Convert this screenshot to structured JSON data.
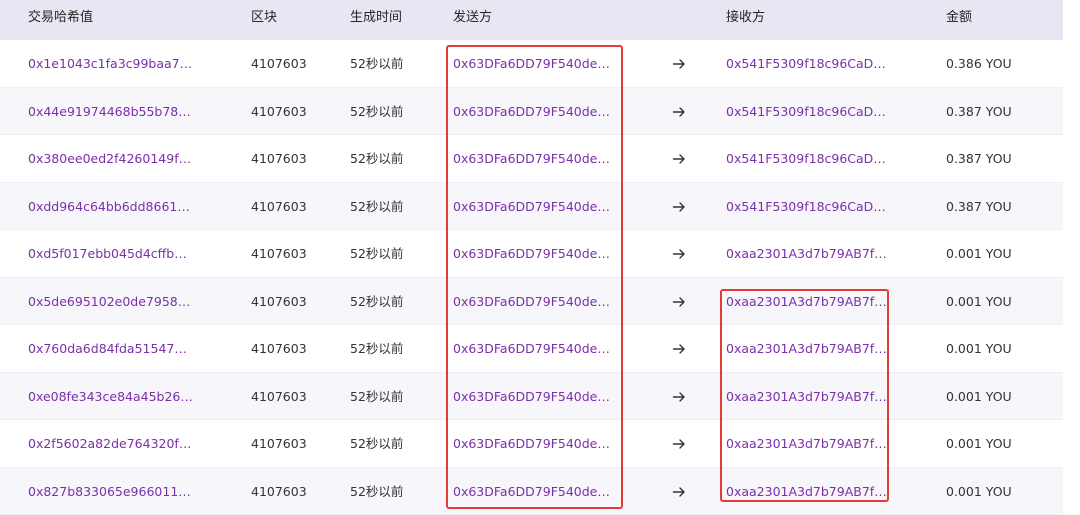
{
  "columns": {
    "hash": "交易哈希值",
    "block": "区块",
    "time": "生成时间",
    "from": "发送方",
    "to": "接收方",
    "amount": "金额"
  },
  "accent_link_color": "#7b2fa8",
  "highlight_color": "#e53a35",
  "rows": [
    {
      "hash": "0x1e1043c1fa3c99baa7…",
      "block": "4107603",
      "time": "52秒以前",
      "from": "0x63DFa6DD79F540de…",
      "to": "0x541F5309f18c96CaD…",
      "amount": "0.386 YOU"
    },
    {
      "hash": "0x44e91974468b55b78…",
      "block": "4107603",
      "time": "52秒以前",
      "from": "0x63DFa6DD79F540de…",
      "to": "0x541F5309f18c96CaD…",
      "amount": "0.387 YOU"
    },
    {
      "hash": "0x380ee0ed2f4260149f…",
      "block": "4107603",
      "time": "52秒以前",
      "from": "0x63DFa6DD79F540de…",
      "to": "0x541F5309f18c96CaD…",
      "amount": "0.387 YOU"
    },
    {
      "hash": "0xdd964c64bb6dd8661…",
      "block": "4107603",
      "time": "52秒以前",
      "from": "0x63DFa6DD79F540de…",
      "to": "0x541F5309f18c96CaD…",
      "amount": "0.387 YOU"
    },
    {
      "hash": "0xd5f017ebb045d4cffb…",
      "block": "4107603",
      "time": "52秒以前",
      "from": "0x63DFa6DD79F540de…",
      "to": "0xaa2301A3d7b79AB7f…",
      "amount": "0.001 YOU"
    },
    {
      "hash": "0x5de695102e0de7958…",
      "block": "4107603",
      "time": "52秒以前",
      "from": "0x63DFa6DD79F540de…",
      "to": "0xaa2301A3d7b79AB7f…",
      "amount": "0.001 YOU"
    },
    {
      "hash": "0x760da6d84fda51547…",
      "block": "4107603",
      "time": "52秒以前",
      "from": "0x63DFa6DD79F540de…",
      "to": "0xaa2301A3d7b79AB7f…",
      "amount": "0.001 YOU"
    },
    {
      "hash": "0xe08fe343ce84a45b26…",
      "block": "4107603",
      "time": "52秒以前",
      "from": "0x63DFa6DD79F540de…",
      "to": "0xaa2301A3d7b79AB7f…",
      "amount": "0.001 YOU"
    },
    {
      "hash": "0x2f5602a82de764320f…",
      "block": "4107603",
      "time": "52秒以前",
      "from": "0x63DFa6DD79F540de…",
      "to": "0xaa2301A3d7b79AB7f…",
      "amount": "0.001 YOU"
    },
    {
      "hash": "0x827b833065e966011…",
      "block": "4107603",
      "time": "52秒以前",
      "from": "0x63DFa6DD79F540de…",
      "to": "0xaa2301A3d7b79AB7f…",
      "amount": "0.001 YOU"
    }
  ]
}
